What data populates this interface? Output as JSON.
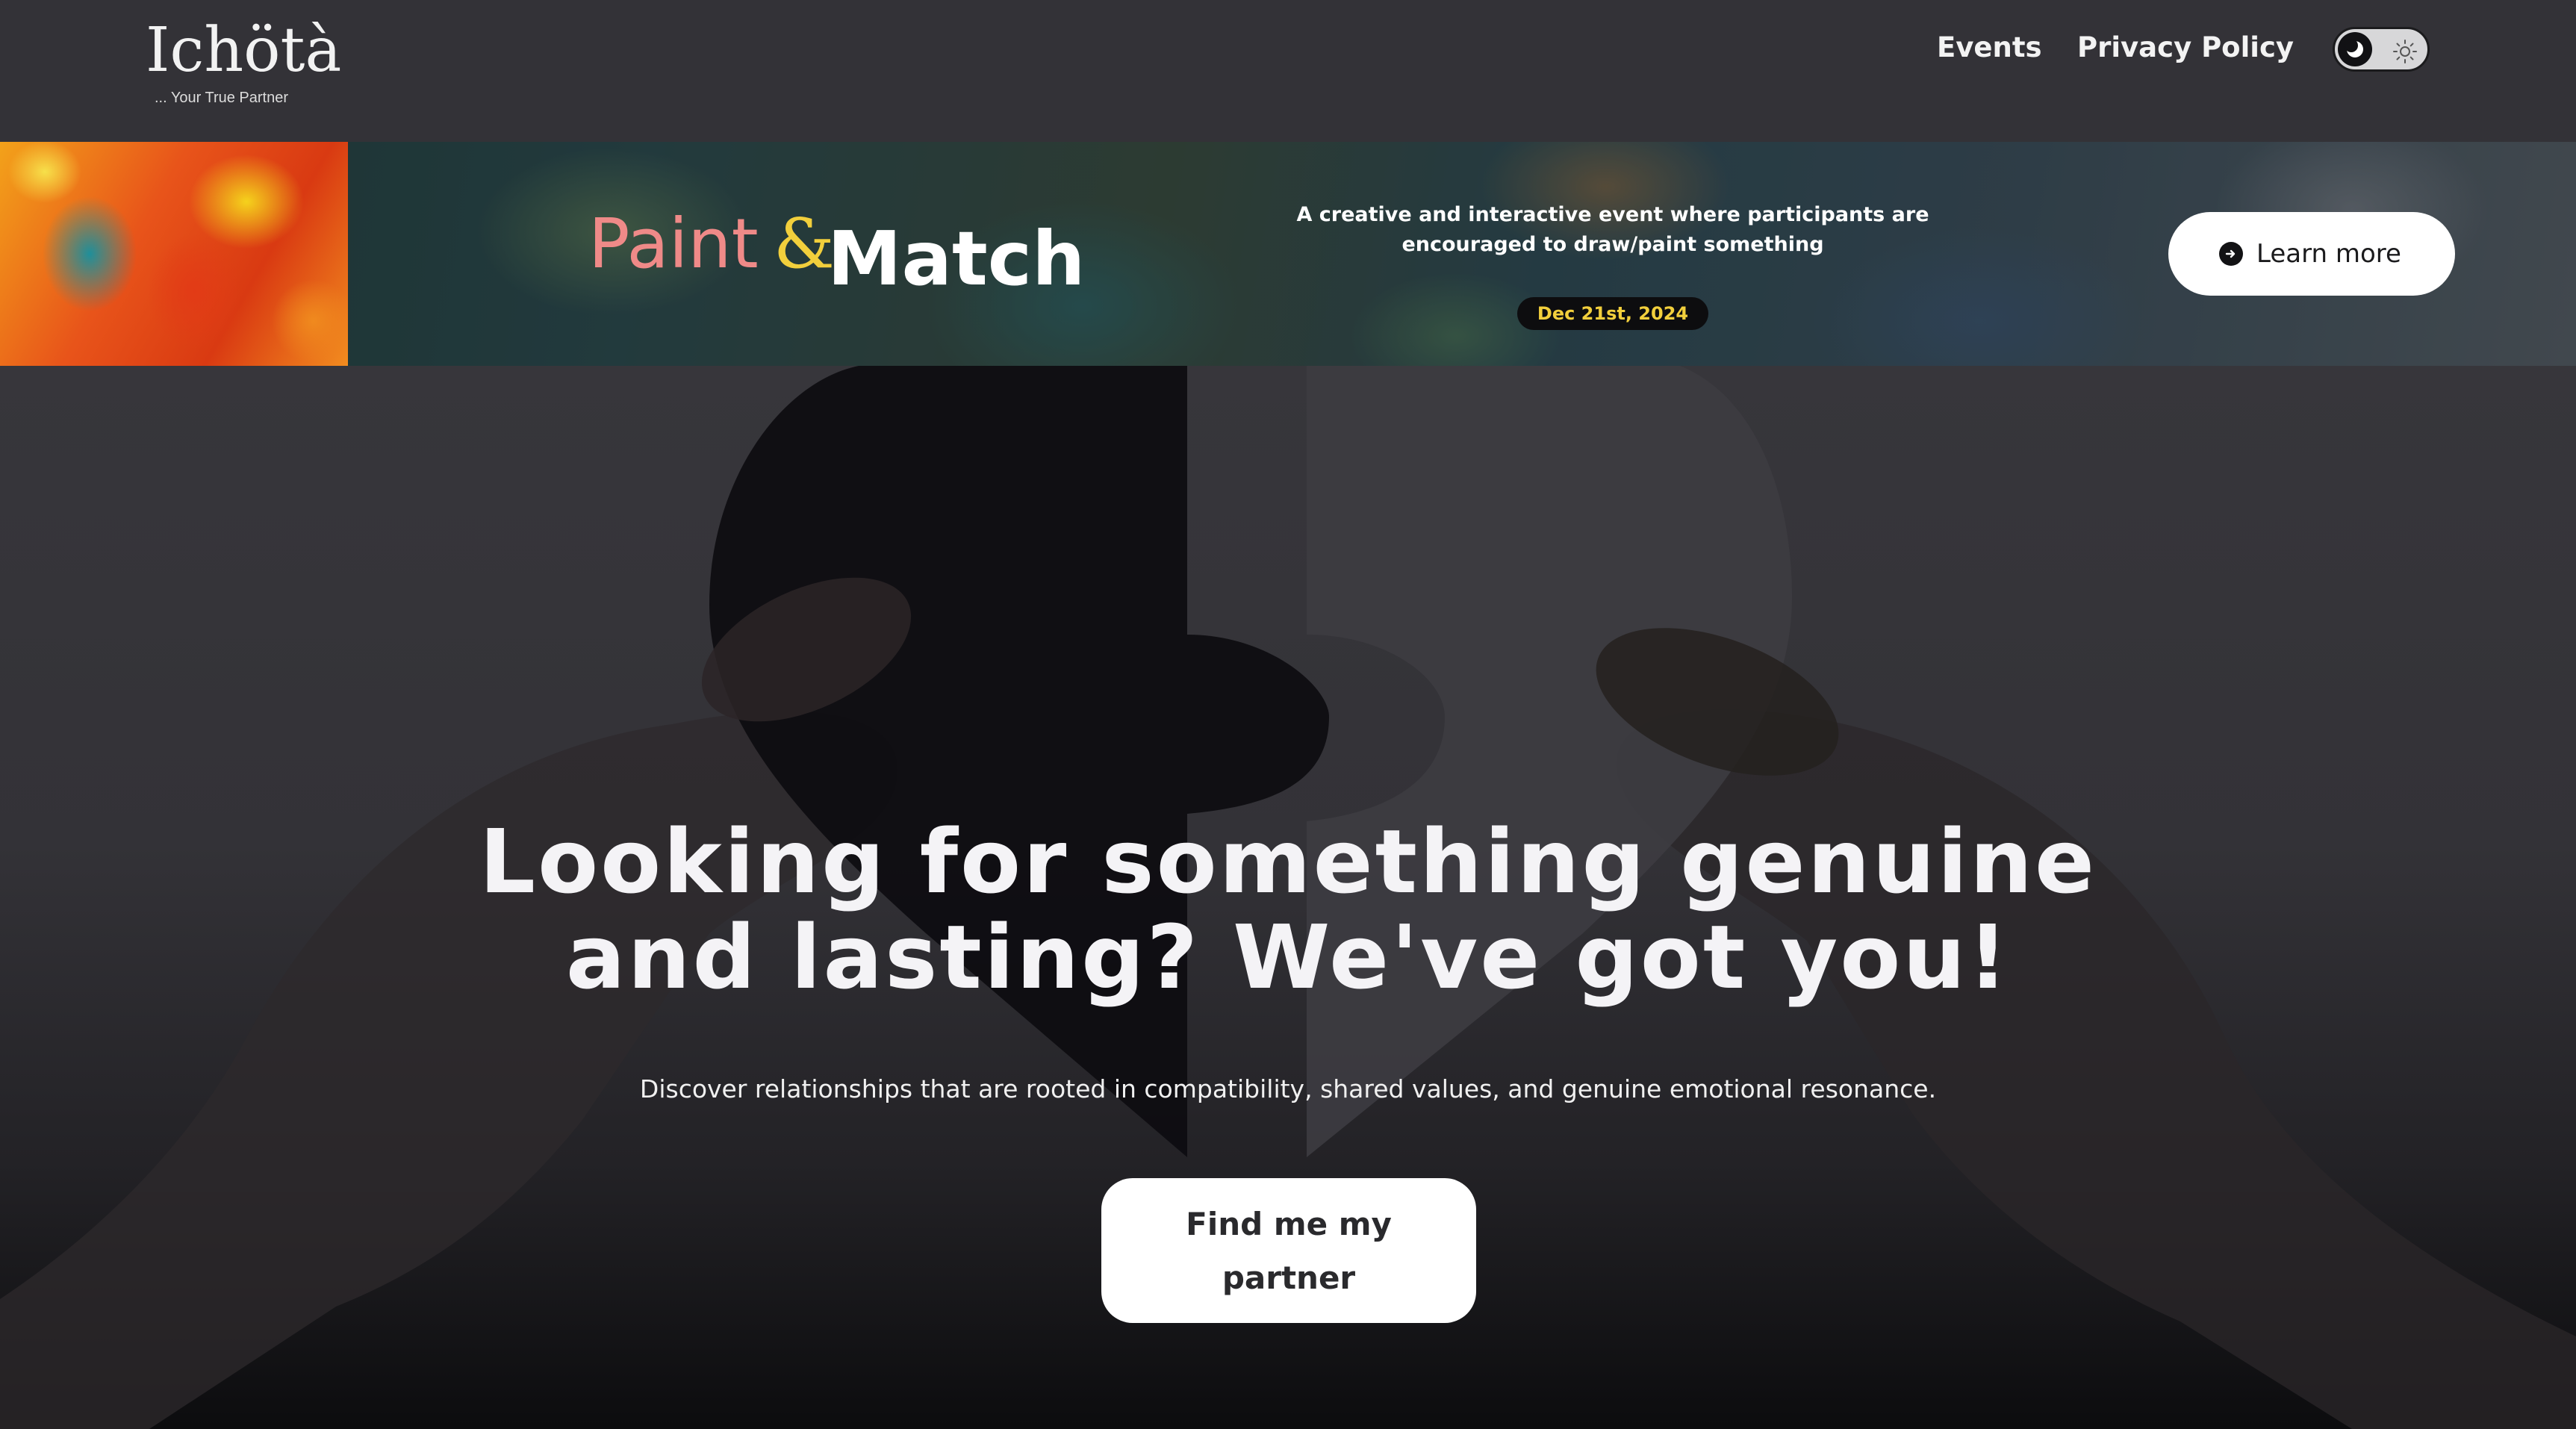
{
  "header": {
    "logo_text": "Ichötà",
    "tagline": "... Your True Partner",
    "nav": [
      {
        "label": "Events"
      },
      {
        "label": "Privacy Policy"
      }
    ],
    "theme_toggle": {
      "state": "dark",
      "icons": [
        "moon-icon",
        "sun-icon"
      ]
    }
  },
  "banner": {
    "brand": {
      "part1": "Paint",
      "amp": "&",
      "part2": "Match"
    },
    "description": "A creative and interactive event where participants are encouraged to draw/paint something",
    "date": "Dec 21st, 2024",
    "cta_label": "Learn more",
    "cta_icon": "arrow-right-circle-icon"
  },
  "hero": {
    "title_line1": "Looking for something genuine",
    "title_line2": "and lasting? We've got you!",
    "subtitle": "Discover relationships that are rooted in compatibility, shared values, and genuine emotional resonance.",
    "cta_line1": "Find me my",
    "cta_line2": "partner"
  },
  "colors": {
    "background": "#333237",
    "paint": "#ef8a88",
    "ampersand": "#f2cf3c",
    "date_badge_text": "#f2cf3c"
  }
}
